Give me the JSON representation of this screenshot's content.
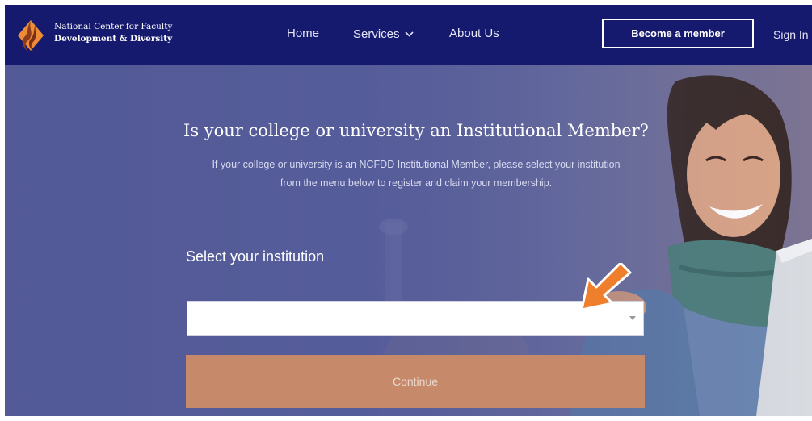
{
  "header": {
    "logo": {
      "line1": "National Center for Faculty",
      "line2": "Development & Diversity",
      "icon": "ncfdd-flame-logo"
    },
    "nav": [
      {
        "label": "Home"
      },
      {
        "label": "Services",
        "icon": "chevron-down-icon"
      },
      {
        "label": "About Us"
      }
    ],
    "member_button": "Become a member",
    "signin": "Sign In"
  },
  "hero": {
    "title": "Is your college or university an Institutional Member?",
    "subtitle_line1": "If your college or university is an NCFDD Institutional Member, please select your institution",
    "subtitle_line2": "from the menu below to register and claim your membership.",
    "select_label": "Select your institution",
    "select_value": "",
    "select_icon": "caret-down-icon",
    "continue_label": "Continue",
    "annotation_icon": "orange-arrow-icon"
  },
  "colors": {
    "header_bg": "#161a6e",
    "hero_overlay": "#5a629d",
    "continue_bg": "#c68a6a",
    "arrow": "#f07f2d"
  }
}
